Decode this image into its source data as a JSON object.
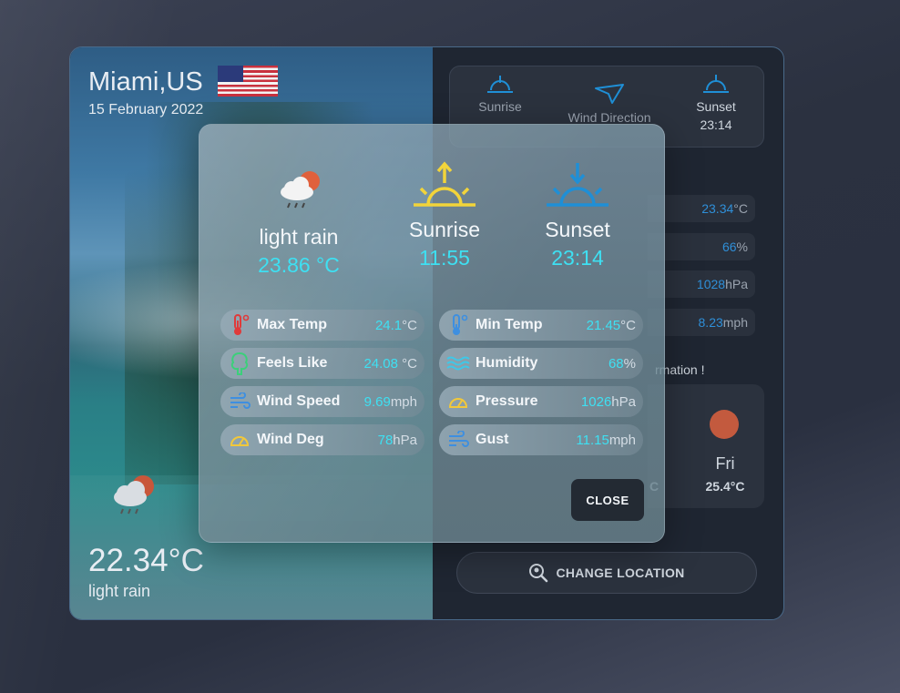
{
  "location": {
    "city": "Miami,US",
    "date": "15 February 2022",
    "flag": "us-flag-icon"
  },
  "current": {
    "temp": "22.34°C",
    "description": "light rain",
    "icon": "rain-cloud-sun-icon"
  },
  "right_panel": {
    "sun": {
      "sunrise_label": "Sunrise",
      "wind_direction_label": "Wind Direction",
      "sunset_label": "Sunset",
      "sunset_value": "23:14"
    },
    "stats": [
      {
        "num": "23.34",
        "unit": "°C"
      },
      {
        "num": "66",
        "unit": "%"
      },
      {
        "num": "1028",
        "unit": "hPa"
      },
      {
        "num": "8.23",
        "unit": "mph"
      }
    ],
    "info_text": "rmation !",
    "forecast": {
      "prev_temp_fragment": "C",
      "day": "Fri",
      "temp": "25.4°C"
    },
    "change_location_label": "CHANGE LOCATION"
  },
  "modal": {
    "weather": {
      "label": "light rain",
      "value": "23.86 °C"
    },
    "sunrise": {
      "label": "Sunrise",
      "value": "11:55"
    },
    "sunset": {
      "label": "Sunset",
      "value": "23:14"
    },
    "details_left": [
      {
        "label": "Max Temp",
        "num": "24.1",
        "unit": "°C",
        "icon": "thermometer-hot-icon"
      },
      {
        "label": "Feels Like",
        "num": "24.08",
        "unit": " °C",
        "icon": "tree-icon"
      },
      {
        "label": "Wind Speed",
        "num": "9.69",
        "unit": "mph",
        "icon": "wind-icon"
      },
      {
        "label": "Wind Deg",
        "num": "78",
        "unit": "hPa",
        "icon": "gauge-icon"
      }
    ],
    "details_right": [
      {
        "label": "Min Temp",
        "num": "21.45",
        "unit": "°C",
        "icon": "thermometer-cold-icon"
      },
      {
        "label": "Humidity",
        "num": "68",
        "unit": "%",
        "icon": "waves-icon"
      },
      {
        "label": "Pressure",
        "num": "1026",
        "unit": "hPa",
        "icon": "gauge-icon"
      },
      {
        "label": "Gust",
        "num": "11.15",
        "unit": "mph",
        "icon": "wind-icon"
      }
    ],
    "close_label": "CLOSE"
  },
  "colors": {
    "accent_cyan": "#3ee0f2",
    "accent_blue": "#2f8fd8",
    "sun_yellow": "#f2d43a",
    "sun_blue": "#1f8fd6"
  }
}
